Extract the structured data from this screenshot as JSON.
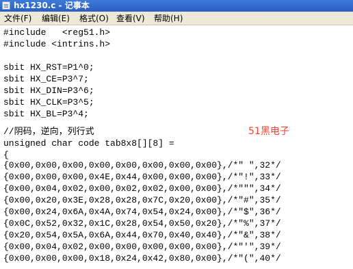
{
  "window": {
    "title": "hx1230.c - 记事本"
  },
  "menu": [
    "文件(F)",
    "编辑(E)",
    "格式(O)",
    "查看(V)",
    "帮助(H)"
  ],
  "editor": {
    "lines": [
      "#include   <reg51.h>",
      "#include <intrins.h>",
      "",
      "sbit HX_RST=P1^0;",
      "sbit HX_CE=P3^7;",
      "sbit HX_DIN=P3^6;",
      "sbit HX_CLK=P3^5;",
      "sbit HX_BL=P3^4;",
      "",
      "//阴码，逆向，列行式",
      "unsigned char code tab8x8[][8] =",
      "{",
      "{0x00,0x00,0x00,0x00,0x00,0x00,0x00,0x00},/*\" \",32*/",
      "{0x00,0x00,0x00,0x4E,0x44,0x00,0x00,0x00},/*\"!\",33*/",
      "{0x00,0x04,0x02,0x00,0x02,0x02,0x00,0x00},/*\"\"\",34*/",
      "{0x00,0x20,0x3E,0x28,0x28,0x7C,0x20,0x00},/*\"#\",35*/",
      "{0x00,0x24,0x6A,0x4A,0x74,0x54,0x24,0x00},/*\"$\",36*/",
      "{0x0C,0x52,0x32,0x1C,0x28,0x54,0x50,0x20},/*\"%\",37*/",
      "{0x20,0x54,0x5A,0x6A,0x44,0x70,0x40,0x40},/*\"&\",38*/",
      "{0x00,0x04,0x02,0x00,0x00,0x00,0x00,0x00},/*\"'\",39*/",
      "{0x00,0x00,0x00,0x18,0x24,0x42,0x80,0x00},/*\"(\",40*/"
    ],
    "watermark": "51黑电子"
  }
}
